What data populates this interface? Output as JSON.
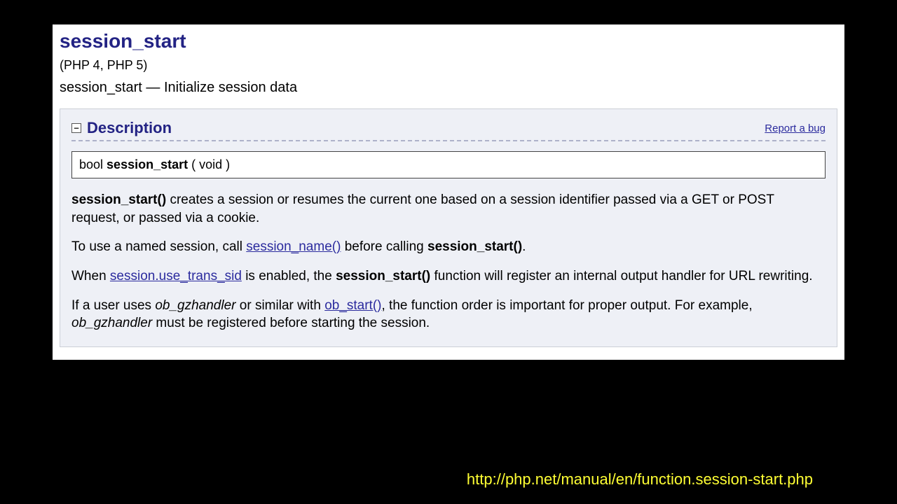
{
  "header": {
    "function_name": "session_start",
    "versions": "(PHP 4, PHP 5)",
    "summary_before": "session_start — ",
    "summary_text": "Initialize session data"
  },
  "description": {
    "title": "Description",
    "report_bug": "Report a bug",
    "collapse_glyph": "−",
    "signature": {
      "return_type": "bool",
      "name": "session_start",
      "params": "( void )"
    },
    "para1": {
      "strong1": "session_start()",
      "text1": " creates a session or resumes the current one based on a session identifier passed via a GET or POST request, or passed via a cookie."
    },
    "para2": {
      "text1": "To use a named session, call ",
      "link1": "session_name()",
      "text2": " before calling ",
      "strong1": "session_start()",
      "text3": "."
    },
    "para3": {
      "text1": "When ",
      "link1": "session.use_trans_sid",
      "text2": " is enabled, the ",
      "strong1": "session_start()",
      "text3": " function will register an internal output handler for URL rewriting."
    },
    "para4": {
      "text1": "If a user uses ",
      "ital1": "ob_gzhandler",
      "text2": " or similar with ",
      "link1": "ob_start()",
      "text3": ", the function order is important for proper output. For example, ",
      "ital2": "ob_gzhandler",
      "text4": " must be registered before starting the session."
    }
  },
  "footer": {
    "url": "http://php.net/manual/en/function.session-start.php"
  }
}
